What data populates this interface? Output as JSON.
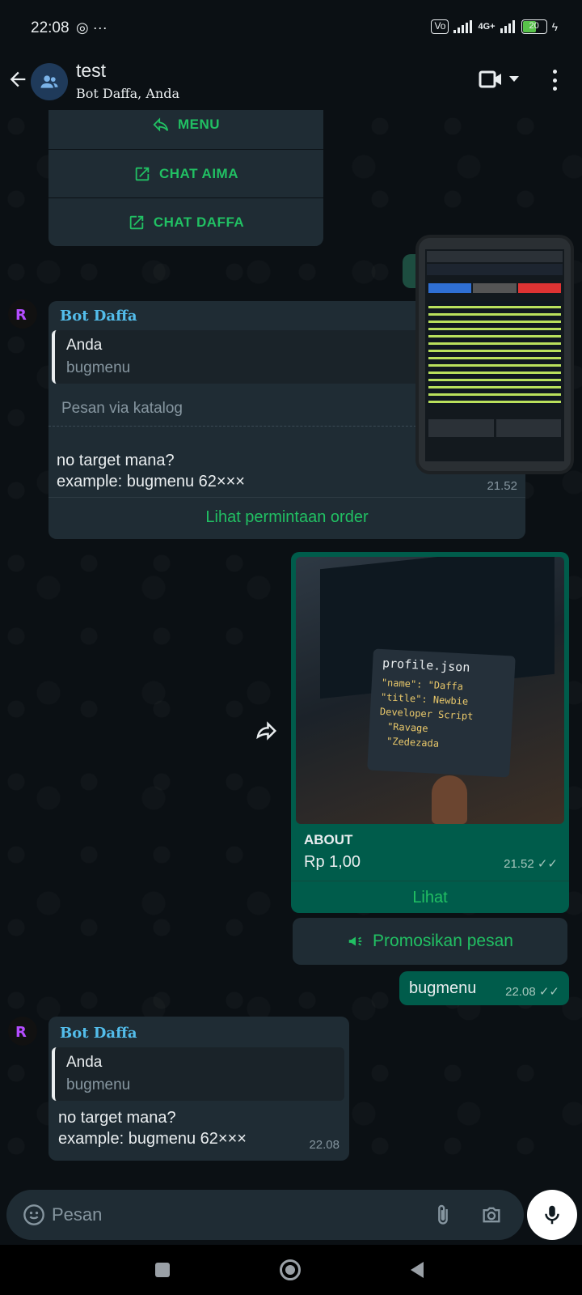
{
  "status_bar": {
    "time": "22:08",
    "battery": "20",
    "network": "4G+"
  },
  "header": {
    "title": "test",
    "subtitle": "Bot Daffa, Anda"
  },
  "menu_buttons": [
    {
      "label": "MENU",
      "icon": "reply-icon"
    },
    {
      "label": "CHAT AIMA",
      "icon": "open-external-icon"
    },
    {
      "label": "CHAT DAFFA",
      "icon": "open-external-icon"
    }
  ],
  "message1": {
    "sender": "Bot Daffa",
    "quote_author": "Anda",
    "quote_text": "bugmenu",
    "catalog_label": "Pesan via katalog",
    "line1": "no target mana?",
    "line2": "example: bugmenu 62×××",
    "time": "21.52",
    "order_link": "Lihat permintaan order"
  },
  "product_message": {
    "card_title": "profile.json",
    "code_lines": [
      "\"name\": \"Daffa",
      "\"title\": Newbie",
      "Developer Script",
      "\"Ravage",
      "\"Zedezada"
    ],
    "title": "ABOUT",
    "price": "Rp 1,00",
    "time": "21.52",
    "action": "Lihat",
    "promote": "Promosikan pesan"
  },
  "outgoing_message": {
    "text": "bugmenu",
    "time": "22.08"
  },
  "message2": {
    "sender": "Bot Daffa",
    "quote_author": "Anda",
    "quote_text": "bugmenu",
    "line1": "no target mana?",
    "line2": "example: bugmenu 62×××",
    "time": "22.08"
  },
  "input": {
    "placeholder": "Pesan"
  },
  "colors": {
    "accent": "#21c063",
    "outgoing_bubble": "#005c4b",
    "incoming_bubble": "#1f2c34",
    "sender_name": "#53bdeb"
  }
}
